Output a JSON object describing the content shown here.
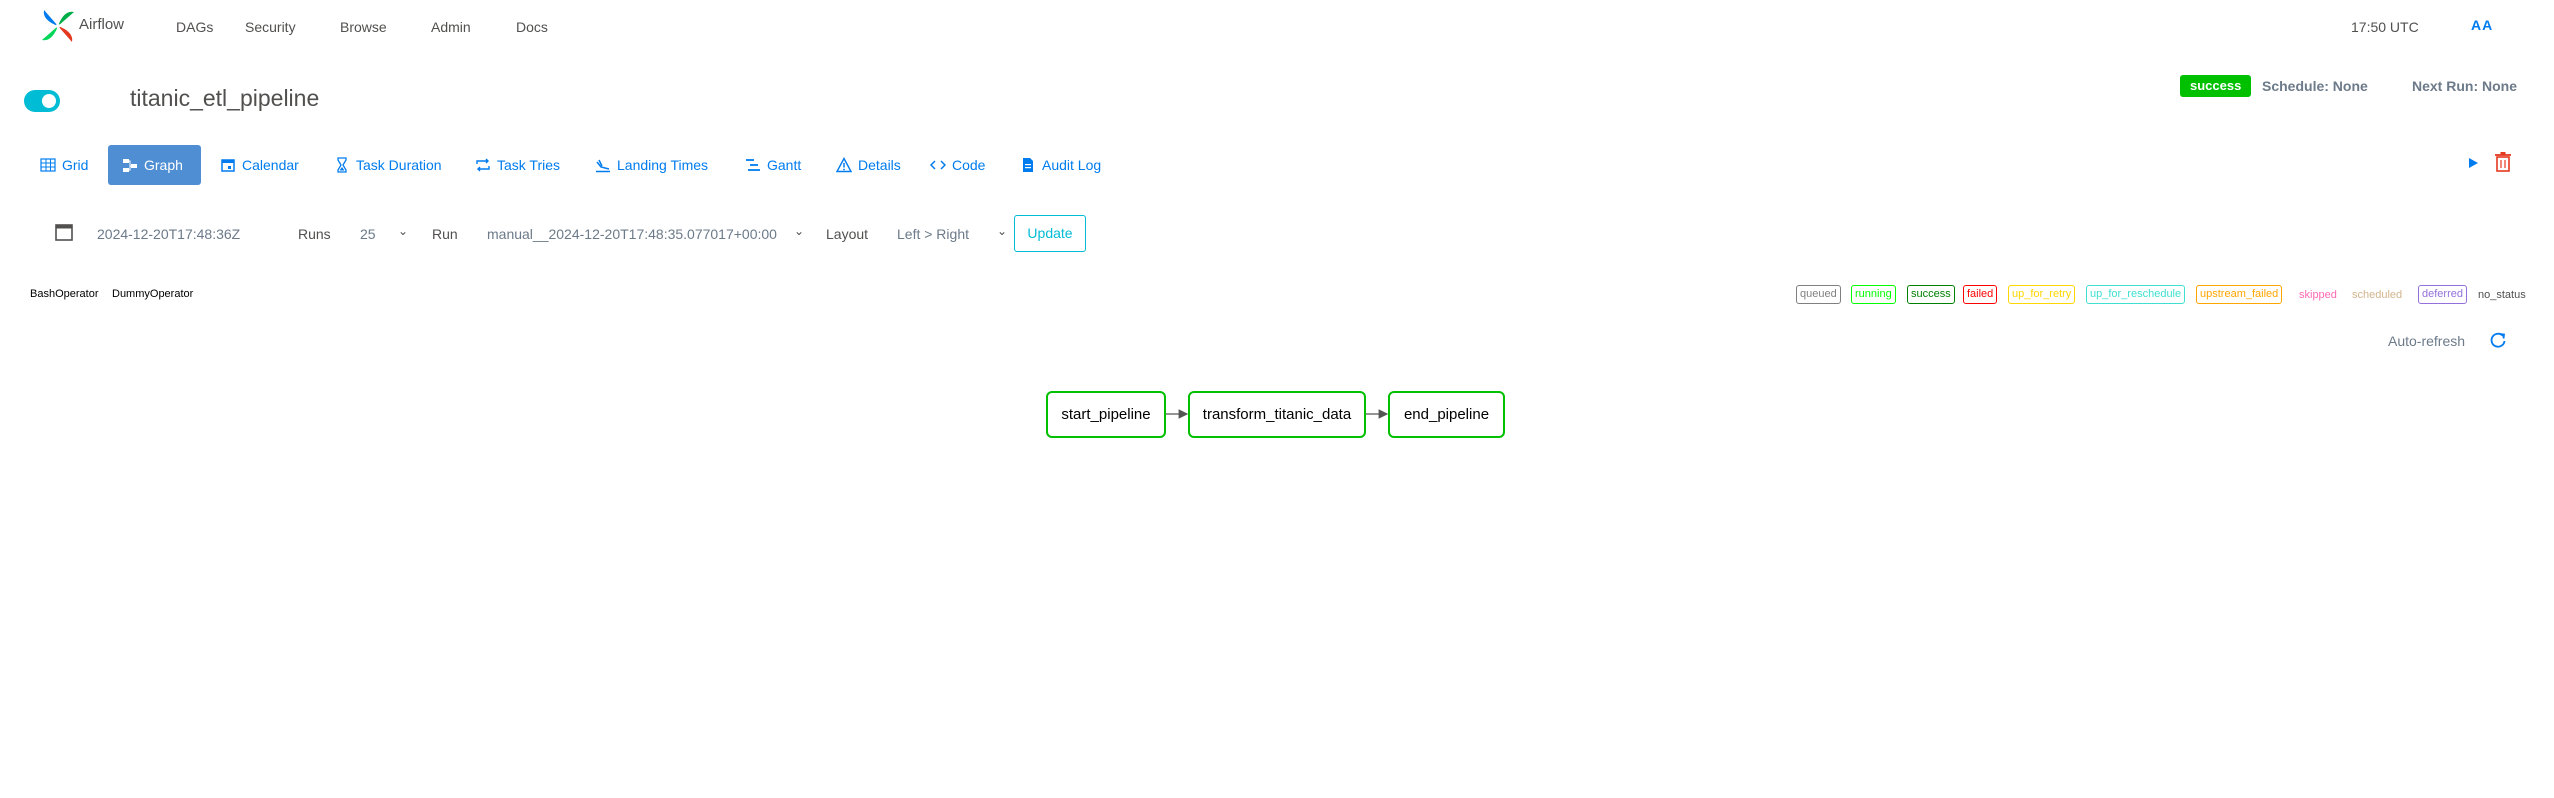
{
  "navbar": {
    "brand": "Airflow",
    "items": [
      {
        "label": "DAGs"
      },
      {
        "label": "Security"
      },
      {
        "label": "Browse"
      },
      {
        "label": "Admin"
      },
      {
        "label": "Docs"
      }
    ],
    "clock": "17:50 UTC",
    "user_initials": "AA"
  },
  "dag": {
    "title": "titanic_etl_pipeline",
    "paused": false,
    "state": "success",
    "schedule": "Schedule: None",
    "next_run": "Next Run: None"
  },
  "tabs": [
    {
      "label": "Grid",
      "icon": "grid-icon",
      "active": false
    },
    {
      "label": "Graph",
      "icon": "graph-icon",
      "active": true
    },
    {
      "label": "Calendar",
      "icon": "calendar-icon",
      "active": false
    },
    {
      "label": "Task Duration",
      "icon": "hourglass-icon",
      "active": false
    },
    {
      "label": "Task Tries",
      "icon": "retry-icon",
      "active": false
    },
    {
      "label": "Landing Times",
      "icon": "landing-icon",
      "active": false
    },
    {
      "label": "Gantt",
      "icon": "gantt-icon",
      "active": false
    },
    {
      "label": "Details",
      "icon": "warning-triangle-icon",
      "active": false
    },
    {
      "label": "Code",
      "icon": "code-icon",
      "active": false
    },
    {
      "label": "Audit Log",
      "icon": "document-icon",
      "active": false
    }
  ],
  "filters": {
    "base_date": "2024-12-20T17:48:36Z",
    "runs_label": "Runs",
    "runs_value": "25",
    "run_label": "Run",
    "run_value": "manual__2024-12-20T17:48:35.077017+00:00",
    "layout_label": "Layout",
    "layout_value": "Left > Right",
    "update_label": "Update"
  },
  "operators": [
    "BashOperator",
    "DummyOperator"
  ],
  "legend": [
    {
      "label": "queued",
      "color": "#808080",
      "bordered": true
    },
    {
      "label": "running",
      "color": "#00ff00",
      "bordered": true
    },
    {
      "label": "success",
      "color": "#008000",
      "bordered": true
    },
    {
      "label": "failed",
      "color": "#ff0000",
      "bordered": true
    },
    {
      "label": "up_for_retry",
      "color": "#ffd700",
      "bordered": true
    },
    {
      "label": "up_for_reschedule",
      "color": "#40e0d0",
      "bordered": true
    },
    {
      "label": "upstream_failed",
      "color": "#ffa500",
      "bordered": true
    },
    {
      "label": "skipped",
      "color": "#ff69b4",
      "bordered": false
    },
    {
      "label": "scheduled",
      "color": "#d2b48c",
      "bordered": false
    },
    {
      "label": "deferred",
      "color": "#9370db",
      "bordered": true
    },
    {
      "label": "no_status",
      "color": "#51504f",
      "bordered": false
    }
  ],
  "auto_refresh_label": "Auto-refresh",
  "graph": {
    "nodes": [
      {
        "id": "start_pipeline",
        "label": "start_pipeline",
        "state": "success"
      },
      {
        "id": "transform_titanic_data",
        "label": "transform_titanic_data",
        "state": "success"
      },
      {
        "id": "end_pipeline",
        "label": "end_pipeline",
        "state": "success"
      }
    ]
  },
  "colors": {
    "accent": "#017cee",
    "success": "#00c000",
    "toggle": "#00bcd4",
    "active_tab": "#4f8ed3"
  }
}
